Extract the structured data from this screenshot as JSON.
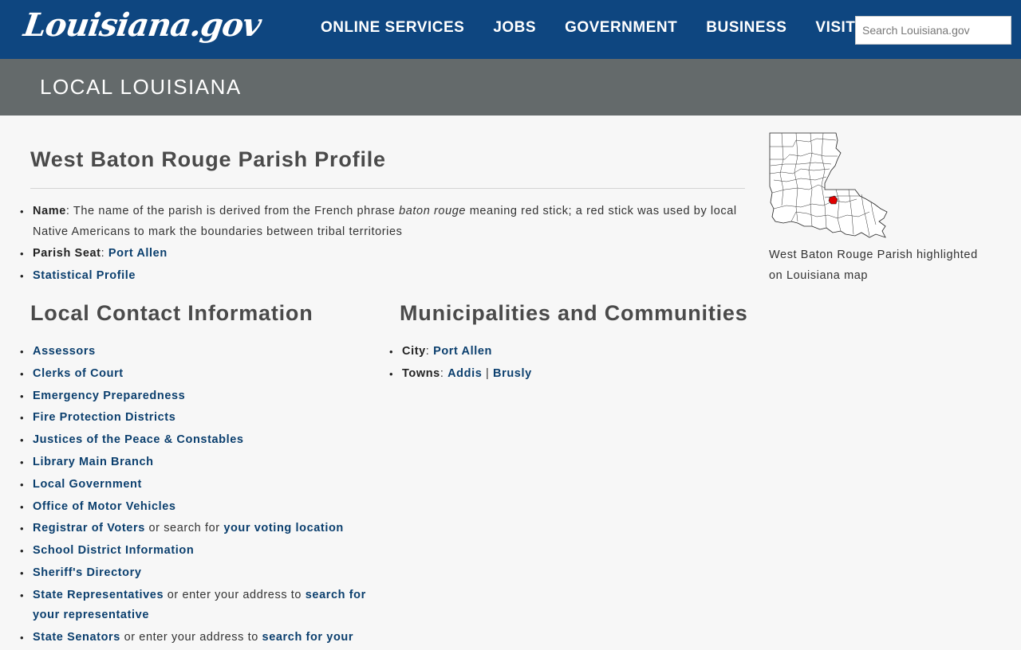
{
  "header": {
    "logo_text": "Louisiana.gov",
    "nav": [
      "ONLINE SERVICES",
      "JOBS",
      "GOVERNMENT",
      "BUSINESS",
      "VISIT"
    ],
    "search_placeholder": "Search Louisiana.gov"
  },
  "banner": {
    "title": "LOCAL LOUISIANA"
  },
  "profile": {
    "title": "West Baton Rouge Parish Profile",
    "name_label": "Name",
    "name_text_1": ": The name of the parish is derived from the French phrase ",
    "name_italic": "baton rouge",
    "name_text_2": " meaning red stick; a red stick was used by local Native Americans to mark the boundaries between tribal territories",
    "seat_label": "Parish Seat",
    "seat_sep": ": ",
    "seat_link": "Port Allen",
    "stat_link": "Statistical Profile"
  },
  "contact": {
    "title": "Local Contact Information",
    "items": [
      "Assessors",
      "Clerks of Court",
      "Emergency Preparedness",
      "Fire Protection Districts",
      "Justices of the Peace & Constables",
      "Library Main Branch",
      "Local Government",
      "Office of Motor Vehicles"
    ],
    "registrar_link": "Registrar of Voters",
    "registrar_mid": " or search for ",
    "registrar_link2": "your voting location",
    "items2": [
      "School District Information",
      "Sheriff's Directory"
    ],
    "reps_link": "State Representatives",
    "reps_mid": " or enter your address to ",
    "reps_link2": "search for your representative",
    "senators_link": "State Senators",
    "senators_mid": " or enter your address to ",
    "senators_link2": "search for your"
  },
  "municipalities": {
    "title": "Municipalities and Communities",
    "city_label": "City",
    "city_link": "Port Allen",
    "towns_label": "Towns",
    "town1": "Addis",
    "separator": " | ",
    "town2": "Brusly"
  },
  "aside": {
    "caption": "West Baton Rouge Parish highlighted on Louisiana map",
    "highlight_color": "#e00000"
  }
}
